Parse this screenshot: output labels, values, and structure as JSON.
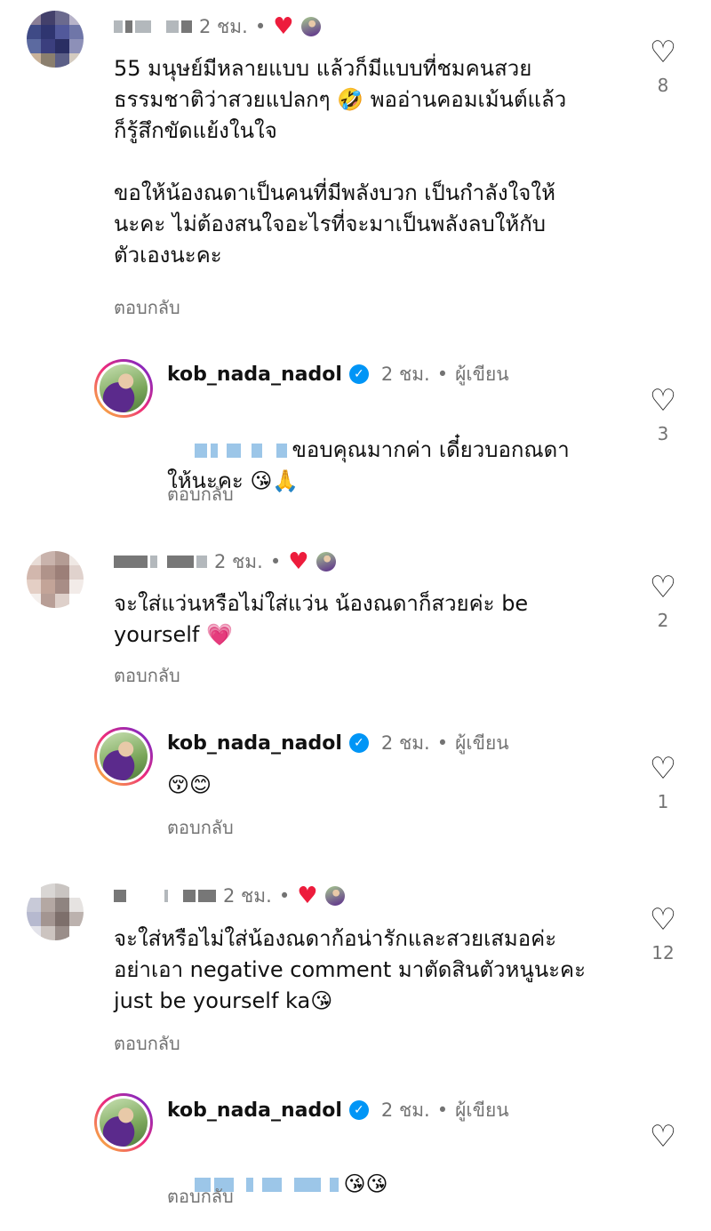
{
  "comments": [
    {
      "time": "2 ชม.",
      "text": "55 มนุษย์มีหลายแบบ แล้วก็มีแบบที่ชมคนสวย\nธรรมชาติว่าสวยแปลกๆ 🤣 พออ่านคอมเม้นต์แล้ว\nก็รู้สึกขัดแย้งในใจ\n\nขอให้น้องณดาเป็นคนที่มีพลังบวก เป็นกำลังใจให้\nนะคะ ไม่ต้องสนใจอะไรที่จะมาเป็นพลังลบให้กับ\nตัวเองนะคะ",
      "reply_label": "ตอบกลับ",
      "like_count": "8"
    },
    {
      "username": "kob_nada_nadol",
      "time": "2 ชม.",
      "author_label": "ผู้เขียน",
      "text": "ขอบคุณมากค่า เดี๋ยวบอกณดา\nให้นะคะ 😘🙏",
      "reply_label": "ตอบกลับ",
      "like_count": "3"
    },
    {
      "time": "2 ชม.",
      "text": "จะใส่แว่นหรือไม่ใส่แว่น น้องณดาก็สวยค่ะ be\nyourself 💗",
      "reply_label": "ตอบกลับ",
      "like_count": "2"
    },
    {
      "username": "kob_nada_nadol",
      "time": "2 ชม.",
      "author_label": "ผู้เขียน",
      "text": "😚😊",
      "reply_label": "ตอบกลับ",
      "like_count": "1"
    },
    {
      "time": "2 ชม.",
      "text": "จะใส่หรือไม่ใส่น้องณดาก้อน่ารักและสวยเสมอค่ะ\nอย่าเอา negative comment มาตัดสินตัวหนูนะคะ\njust be yourself ka😘",
      "reply_label": "ตอบกลับ",
      "like_count": "12"
    },
    {
      "username": "kob_nada_nadol",
      "time": "2 ชม.",
      "author_label": "ผู้เขียน",
      "text": "😘😘",
      "reply_label": "ตอบกลับ",
      "like_count": ""
    }
  ],
  "icons": {
    "like": "heart-outline-icon",
    "creator_liked": "heart-filled-icon",
    "verified": "verified-badge-icon"
  },
  "colors": {
    "like_red": "#ed1c3c",
    "verified_blue": "#0095f6",
    "meta_gray": "#737373"
  }
}
